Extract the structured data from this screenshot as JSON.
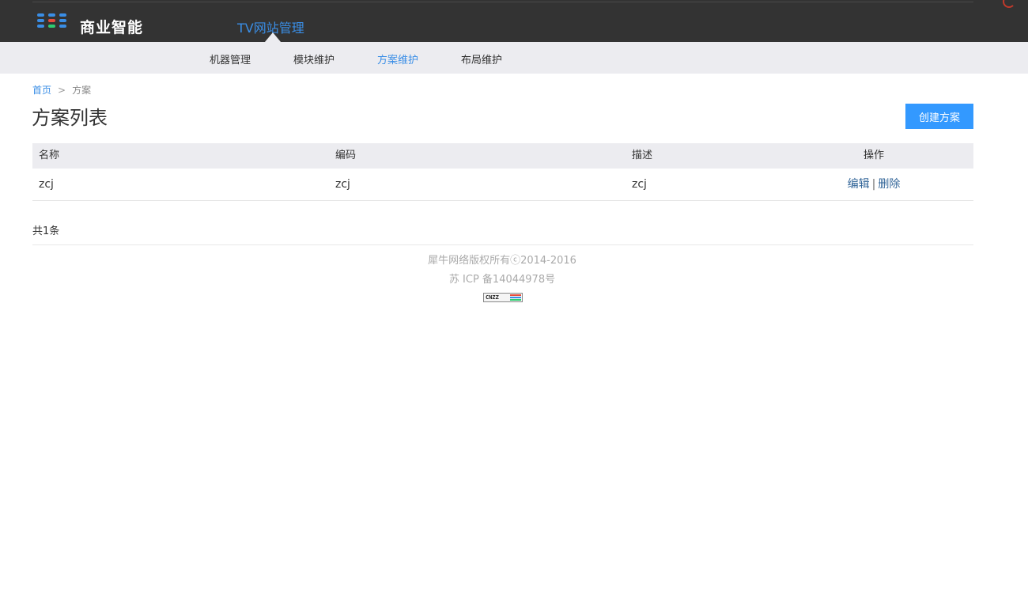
{
  "header": {
    "logo_text": "商业智能",
    "site_title": "TV网站管理",
    "logo_colors": [
      "#3a8ee6",
      "#3a8ee6",
      "#3a8ee6",
      "#3a8ee6",
      "#e74c3c",
      "#3a8ee6",
      "#3a8ee6",
      "#2ecc71",
      "#3a8ee6"
    ]
  },
  "subnav": {
    "items": [
      {
        "label": "机器管理",
        "active": false
      },
      {
        "label": "模块维护",
        "active": false
      },
      {
        "label": "方案维护",
        "active": true
      },
      {
        "label": "布局维护",
        "active": false
      }
    ]
  },
  "breadcrumb": {
    "home": "首页",
    "separator": ">",
    "current": "方案"
  },
  "page": {
    "title": "方案列表",
    "create_button": "创建方案"
  },
  "table": {
    "headers": [
      "名称",
      "编码",
      "描述",
      "操作"
    ],
    "rows": [
      {
        "name": "zcj",
        "code": "zcj",
        "description": "zcj",
        "edit": "编辑",
        "delete": "删除"
      }
    ],
    "action_separator": "|"
  },
  "pagination": {
    "total_text": "共1条"
  },
  "footer": {
    "copyright": "犀牛网络版权所有ⓒ2014-2016",
    "icp": "苏 ICP 备14044978号",
    "badge_text": "CNZZ"
  },
  "colors": {
    "accent": "#3a8ee6",
    "header_bg": "#333333",
    "subnav_bg": "#ececf0",
    "button_bg": "#3399ff",
    "link": "#336699"
  }
}
